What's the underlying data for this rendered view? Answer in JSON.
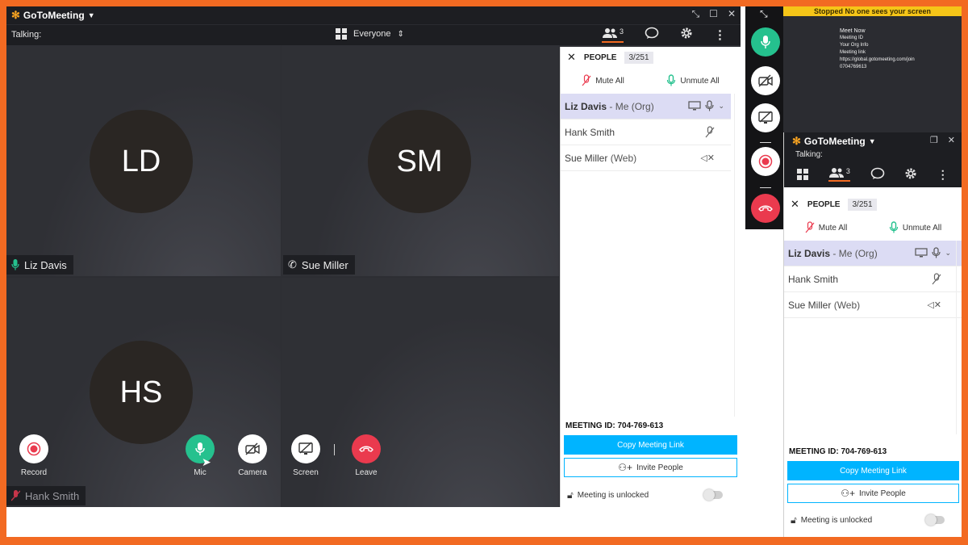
{
  "app": {
    "name": "GoToMeeting"
  },
  "toolbar": {
    "talking_label": "Talking:",
    "view_label": "Everyone",
    "people_count": "3"
  },
  "tiles": [
    {
      "initials": "LD",
      "name": "Liz Davis"
    },
    {
      "initials": "SM",
      "name": "Sue Miller"
    },
    {
      "initials": "HS",
      "name": "Hank Smith"
    }
  ],
  "controls": {
    "record": "Record",
    "mic": "Mic",
    "camera": "Camera",
    "screen": "Screen",
    "leave": "Leave"
  },
  "people_panel": {
    "title": "PEOPLE",
    "count": "3/251",
    "mute_all": "Mute All",
    "unmute_all": "Unmute All",
    "participants": [
      {
        "name": "Liz Davis",
        "detail": "- Me (Org)"
      },
      {
        "name": "Hank Smith",
        "detail": ""
      },
      {
        "name": "Sue Miller",
        "detail": "(Web)"
      }
    ],
    "meeting_id": "MEETING ID: 704-769-613",
    "copy_link": "Copy Meeting Link",
    "invite": "Invite People",
    "lock_status": "Meeting is unlocked"
  },
  "preview": {
    "banner": "Stopped  No one sees your screen",
    "doc_title": "Meet Now",
    "doc_lines": [
      "Meeting ID",
      "Your Org Info",
      "Meeting link",
      "https://global.gotomeeting.com/join",
      "0704769613"
    ]
  },
  "colors": {
    "accent_orange": "#f26a22",
    "mic_green": "#25c18e",
    "leave_red": "#ea3a4e",
    "link_blue": "#00b4ff"
  }
}
